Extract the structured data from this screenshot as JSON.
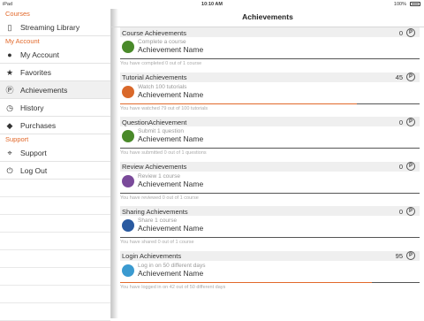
{
  "status_bar": {
    "device": "iPad",
    "time": "10:10 AM",
    "battery": "100%"
  },
  "colors": {
    "accent": "#e2692b",
    "section_header_bg": "#efefef"
  },
  "sidebar": {
    "sections": [
      {
        "title": "Courses",
        "items": [
          {
            "label": "Streaming Library",
            "icon": "book-icon"
          }
        ]
      },
      {
        "title": "My Account",
        "items": [
          {
            "label": "My Account",
            "icon": "person-icon"
          },
          {
            "label": "Favorites",
            "icon": "star-icon"
          },
          {
            "label": "Achievements",
            "icon": "points-icon",
            "active": true
          },
          {
            "label": "History",
            "icon": "clock-icon"
          },
          {
            "label": "Purchases",
            "icon": "tag-icon"
          }
        ]
      },
      {
        "title": "Support",
        "items": [
          {
            "label": "Support",
            "icon": "lifebuoy-icon"
          },
          {
            "label": "Log Out",
            "icon": "power-icon"
          }
        ]
      }
    ]
  },
  "main": {
    "title": "Achievements",
    "groups": [
      {
        "title": "Course Achievements",
        "points": "0",
        "task": "Complete a course",
        "name": "Achievement Name",
        "status": "You have completed 0 out of 1 course",
        "progress": 0,
        "icon_color": "#4a8a2a",
        "icon": "graduate-icon"
      },
      {
        "title": "Tutorial Achievements",
        "points": "45",
        "task": "Watch 100 tutorials",
        "name": "Achievement Name",
        "status": "You have watched 79 out of 100 tutorials",
        "progress": 0.79,
        "icon_color": "#d9682a",
        "icon": "video-badge-icon"
      },
      {
        "title": "QuestionAchievement",
        "points": "0",
        "task": "Submit 1 question",
        "name": "Achievement Name",
        "status": "You have submitted 0 out of 1 questions",
        "progress": 0,
        "icon_color": "#4a8a2a",
        "icon": "question-icon"
      },
      {
        "title": "Review Achievements",
        "points": "0",
        "task": "Review 1 course",
        "name": "Achievement Name",
        "status": "You have reviewed 0 out of 1 course",
        "progress": 0,
        "icon_color": "#7a4a9a",
        "icon": "review-icon"
      },
      {
        "title": "Sharing Achievements",
        "points": "0",
        "task": "Share 1 course",
        "name": "Achievement Name",
        "status": "You have shared 0 out of 1 course",
        "progress": 0,
        "icon_color": "#2a5aa0",
        "icon": "share-icon"
      },
      {
        "title": "Login Achievements",
        "points": "95",
        "task": "Log in on 50 different days",
        "name": "Achievement Name",
        "status": "You have logged in on 42 out of 50 different days",
        "progress": 0.84,
        "icon_color": "#3a9ad0",
        "icon": "login-icon"
      }
    ]
  }
}
